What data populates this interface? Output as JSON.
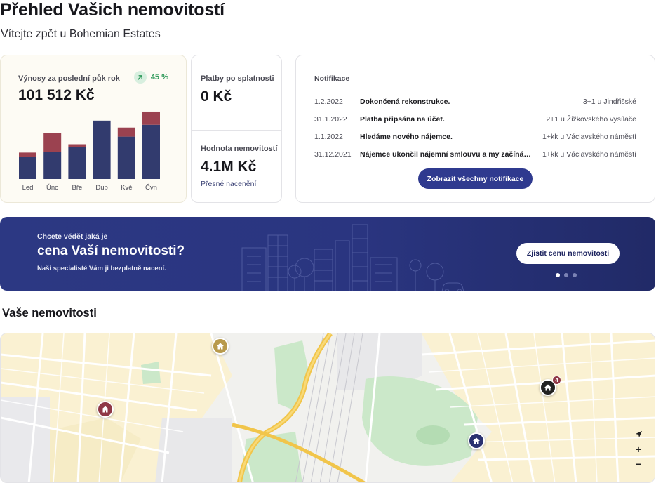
{
  "header": {
    "title": "Přehled Vašich nemovitostí",
    "subtitle": "Vítejte zpět u Bohemian Estates"
  },
  "revenue": {
    "label": "Výnosy za poslední půk rok",
    "change": "45 %",
    "value": "101 512 Kč",
    "colors": {
      "base": "#323b6e",
      "top": "#9b4250"
    }
  },
  "chart_data": {
    "type": "bar",
    "stacked": true,
    "categories": [
      "Led",
      "Úno",
      "Bře",
      "Dub",
      "Kvě",
      "Čvn"
    ],
    "series": [
      {
        "name": "",
        "values": [
          32,
          39,
          46,
          84,
          61,
          78
        ]
      },
      {
        "name": "",
        "values": [
          6,
          27,
          4,
          0,
          13,
          19
        ]
      }
    ],
    "ylim": [
      0,
      100
    ],
    "title": "",
    "xlabel": "",
    "ylabel": ""
  },
  "payments": {
    "label": "Platby po splatnosti",
    "value": "0 Kč"
  },
  "property_value": {
    "label": "Hodnota nemovitostí",
    "value": "4.1M Kč",
    "link": "Přesné nacenění"
  },
  "notifications": {
    "title": "Notifikace",
    "items": [
      {
        "date": "1.2.2022",
        "text": "Dokončená rekonstrukce.",
        "property": "3+1 u Jindřišské"
      },
      {
        "date": "31.1.2022",
        "text": "Platba připsána na účet.",
        "property": "2+1 u Žižkovského vysílače"
      },
      {
        "date": "1.1.2022",
        "text": "Hledáme nového nájemce.",
        "property": "1+kk u Václavského náměstí"
      },
      {
        "date": "31.12.2021",
        "text": "Nájemce ukončil nájemní smlouvu a my začínáme hledat nového nájemce.",
        "property": "1+kk u Václavského náměstí"
      }
    ],
    "button": "Zobrazit všechny notifikace"
  },
  "banner": {
    "small": "Chcete vědět jaká je",
    "big": "cena Vaší nemovitosti?",
    "desc": "Naši specialisté Vám ji bezplatně nacení.",
    "button": "Zjistit cenu nemovitosti",
    "active_slide": 1,
    "slides": 3
  },
  "properties_section": {
    "title": "Vaše nemovitosti"
  },
  "map": {
    "cluster_count": "4",
    "pins": [
      {
        "name": "map-pin-gold",
        "color": "#b89a4c"
      },
      {
        "name": "map-pin-burgundy",
        "color": "#8f3846"
      },
      {
        "name": "map-pin-navy",
        "color": "#2a3270"
      },
      {
        "name": "map-pin-dark",
        "color": "#222222"
      }
    ],
    "controls": {
      "zoom_in": "+",
      "zoom_out": "−"
    }
  }
}
